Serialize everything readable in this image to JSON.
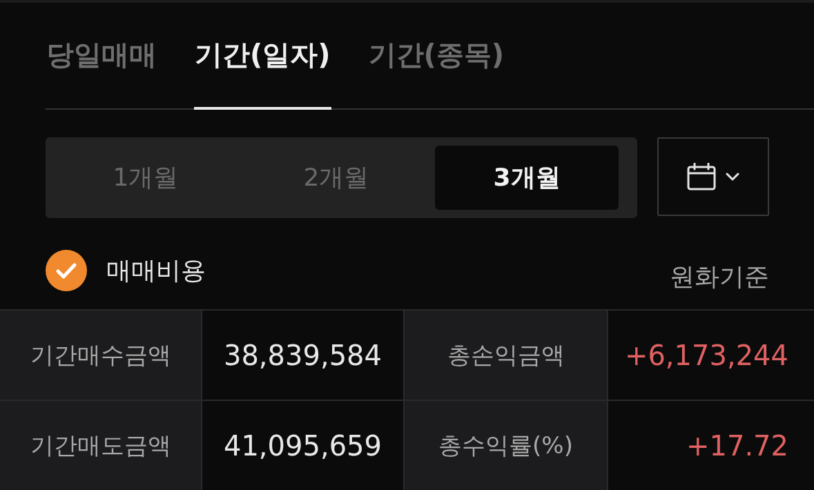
{
  "tabs": [
    {
      "label": "당일매매",
      "selected": false
    },
    {
      "label": "기간(일자)",
      "selected": true
    },
    {
      "label": "기간(종목)",
      "selected": false
    }
  ],
  "periods": [
    {
      "label": "1개월",
      "selected": false
    },
    {
      "label": "2개월",
      "selected": false
    },
    {
      "label": "3개월",
      "selected": true
    }
  ],
  "trade_cost": {
    "label": "매매비용",
    "checked": true
  },
  "currency_basis": "원화기준",
  "summary": {
    "rows": [
      [
        {
          "kind": "label",
          "text": "기간매수금액"
        },
        {
          "kind": "amount",
          "text": "38,839,584"
        },
        {
          "kind": "label",
          "text": "총손익금액"
        },
        {
          "kind": "gain",
          "text": "+6,173,244"
        }
      ],
      [
        {
          "kind": "label",
          "text": "기간매도금액"
        },
        {
          "kind": "amount",
          "text": "41,095,659"
        },
        {
          "kind": "label",
          "text": "총수익률(%)"
        },
        {
          "kind": "gain",
          "text": "+17.72"
        }
      ]
    ]
  }
}
